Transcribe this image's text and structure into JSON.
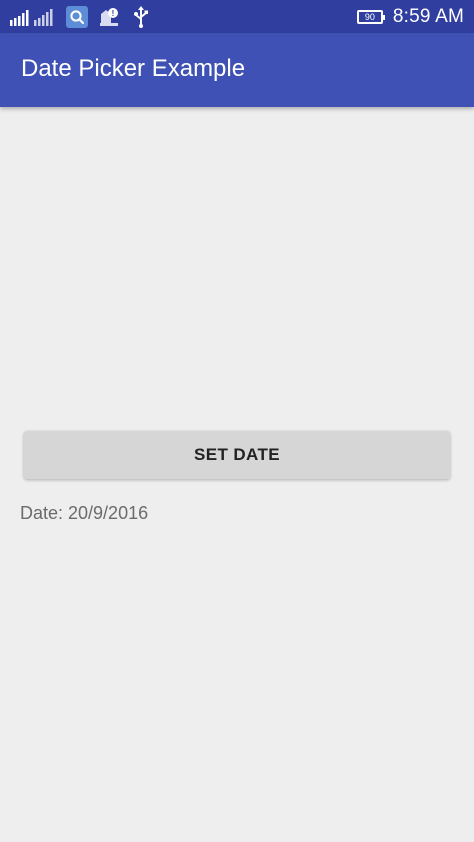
{
  "status_bar": {
    "time": "8:59 AM",
    "battery_level": "90",
    "icons": [
      "signal-icon",
      "search-icon",
      "notification-icon",
      "usb-icon"
    ]
  },
  "app_bar": {
    "title": "Date Picker Example"
  },
  "main": {
    "set_date_button_label": "SET DATE",
    "date_text": "Date: 20/9/2016"
  },
  "colors": {
    "status_bar": "#303f9f",
    "app_bar": "#3f51b5",
    "background": "#eeeeee",
    "button": "#d6d6d6"
  }
}
